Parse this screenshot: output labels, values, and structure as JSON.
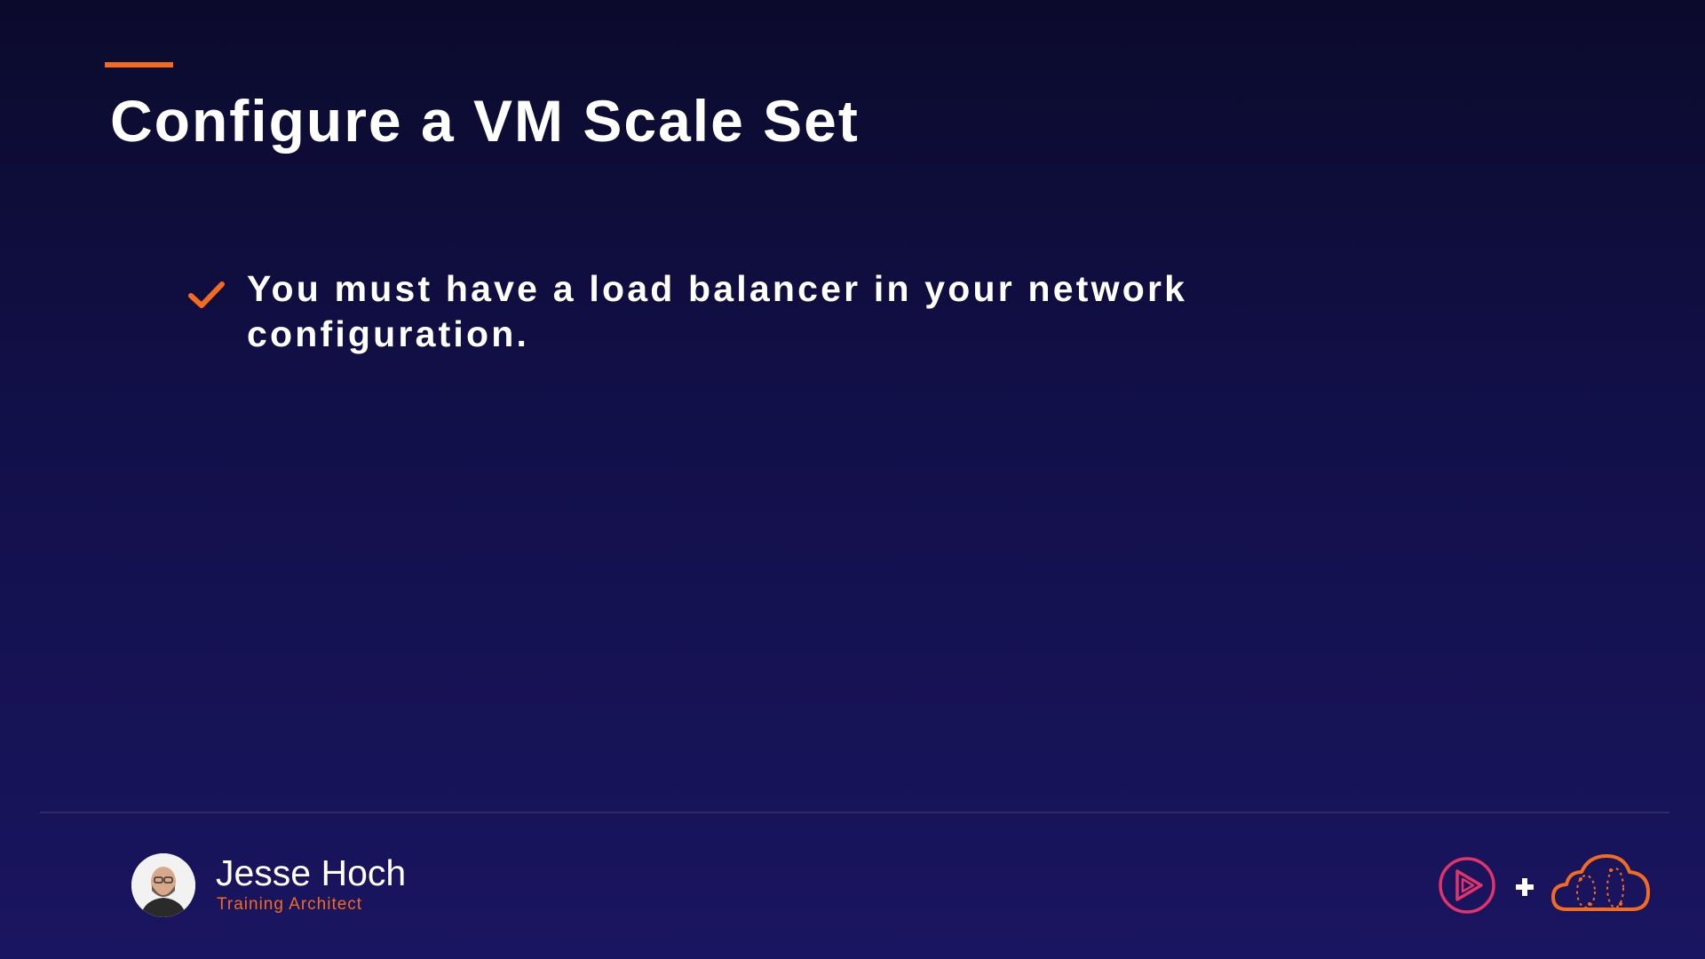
{
  "slide": {
    "title": "Configure a VM Scale Set",
    "bullets": [
      {
        "icon": "check-icon",
        "text": "You must have a load balancer in your network configuration."
      }
    ]
  },
  "presenter": {
    "name": "Jesse Hoch",
    "role": "Training Architect"
  },
  "branding": {
    "left_logo": "play-circle-logo-icon",
    "separator": "plus-icon",
    "right_logo": "cloud-logo-icon"
  },
  "colors": {
    "background_top": "#0b0a2c",
    "background_bottom": "#1a1560",
    "accent_orange": "#f26b21",
    "play_logo": "#e2336b",
    "text": "#ffffff"
  }
}
